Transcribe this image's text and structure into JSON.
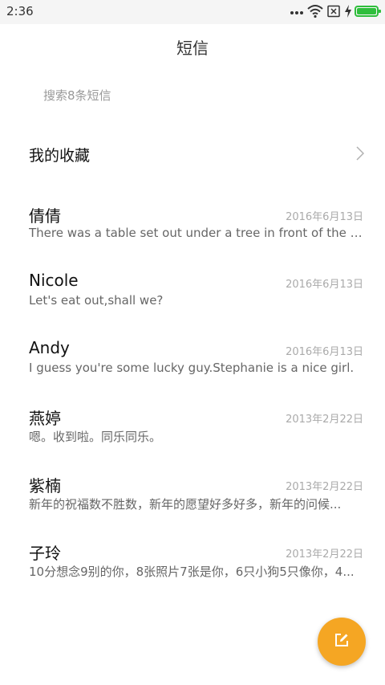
{
  "status_bar": {
    "time": "2:36",
    "icons": [
      "more-dots-icon",
      "wifi-icon",
      "no-sim-icon",
      "charging-icon",
      "battery-icon"
    ],
    "battery_color": "#2fbe3c"
  },
  "header": {
    "title": "短信"
  },
  "search": {
    "placeholder": "搜索8条短信"
  },
  "favorites": {
    "label": "我的收藏",
    "icon": "chevron-right-icon"
  },
  "conversations": [
    {
      "name": "倩倩",
      "date": "2016年6月13日",
      "snippet": "There was a table set out under a tree in front of the house..."
    },
    {
      "name": "Nicole",
      "date": "2016年6月13日",
      "snippet": "Let's eat out,shall we?"
    },
    {
      "name": "Andy",
      "date": "2016年6月13日",
      "snippet": "I guess you're some lucky guy.Stephanie is a nice girl."
    },
    {
      "name": "燕婷",
      "date": "2013年2月22日",
      "snippet": "嗯。收到啦。同乐同乐。"
    },
    {
      "name": "紫楠",
      "date": "2013年2月22日",
      "snippet": "新年的祝福数不胜数，新年的愿望好多好多，新年的问候..."
    },
    {
      "name": "子玲",
      "date": "2013年2月22日",
      "snippet": "10分想念9别的你，8张照片7张是你，6只小狗5只像你，4..."
    }
  ],
  "fab": {
    "icon": "compose-icon",
    "color": "#f5a623"
  }
}
